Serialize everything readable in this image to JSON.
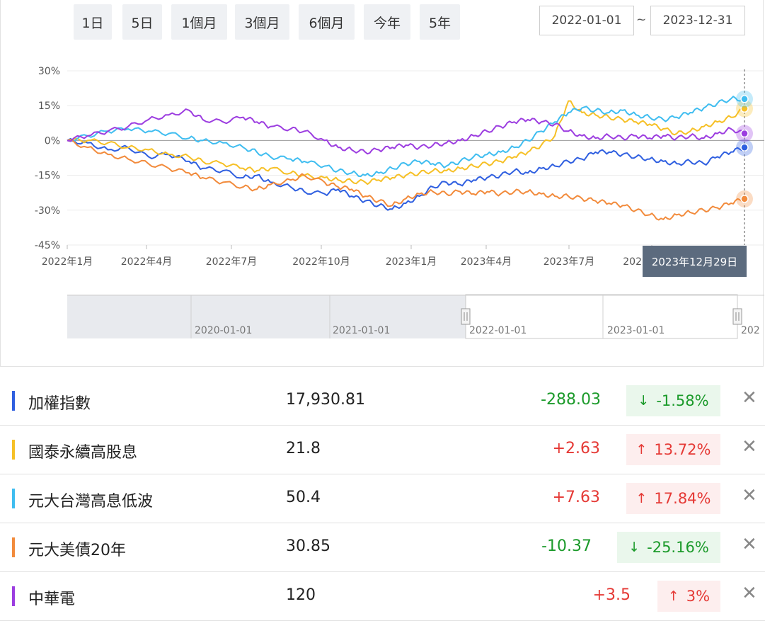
{
  "range_buttons": [
    "1日",
    "5日",
    "1個月",
    "3個月",
    "6個月",
    "今年",
    "5年"
  ],
  "date_range": {
    "start": "2022-01-01",
    "separator": "~",
    "end": "2023-12-31"
  },
  "tooltip_date": "2023年12月29日",
  "navigator": {
    "labels": [
      "2020-01-01",
      "2021-01-01",
      "2022-01-01",
      "2023-01-01",
      "202"
    ]
  },
  "chart_data": {
    "type": "line",
    "x_axis": {
      "tick_labels": [
        "2022年1月",
        "2022年4月",
        "2022年7月",
        "2022年10月",
        "2023年1月",
        "2023年4月",
        "2023年7月",
        "2023年10月"
      ]
    },
    "y_axis": {
      "tick_labels": [
        "30%",
        "15%",
        "0%",
        "-15%",
        "-30%",
        "-45%"
      ],
      "ylim": [
        -45,
        30
      ],
      "unit": "%"
    },
    "grid": true,
    "series": [
      {
        "name": "加權指數",
        "color": "#2f5fe0",
        "points": [
          [
            0,
            0
          ],
          [
            0.03,
            -1
          ],
          [
            0.06,
            -4
          ],
          [
            0.09,
            -3
          ],
          [
            0.12,
            -7
          ],
          [
            0.15,
            -6
          ],
          [
            0.18,
            -9
          ],
          [
            0.2,
            -12
          ],
          [
            0.23,
            -13
          ],
          [
            0.26,
            -16
          ],
          [
            0.28,
            -15
          ],
          [
            0.3,
            -18
          ],
          [
            0.33,
            -20
          ],
          [
            0.35,
            -22
          ],
          [
            0.38,
            -23
          ],
          [
            0.4,
            -21
          ],
          [
            0.42,
            -24
          ],
          [
            0.44,
            -26
          ],
          [
            0.46,
            -28
          ],
          [
            0.48,
            -29.5
          ],
          [
            0.5,
            -27
          ],
          [
            0.52,
            -24
          ],
          [
            0.54,
            -20
          ],
          [
            0.56,
            -18
          ],
          [
            0.58,
            -19
          ],
          [
            0.6,
            -17
          ],
          [
            0.62,
            -16
          ],
          [
            0.64,
            -15
          ],
          [
            0.66,
            -13
          ],
          [
            0.68,
            -14
          ],
          [
            0.7,
            -12
          ],
          [
            0.72,
            -11
          ],
          [
            0.74,
            -9
          ],
          [
            0.76,
            -8
          ],
          [
            0.78,
            -5
          ],
          [
            0.8,
            -5
          ],
          [
            0.82,
            -6
          ],
          [
            0.84,
            -7
          ],
          [
            0.86,
            -8
          ],
          [
            0.88,
            -9
          ],
          [
            0.9,
            -10
          ],
          [
            0.92,
            -9
          ],
          [
            0.94,
            -10
          ],
          [
            0.96,
            -7
          ],
          [
            0.98,
            -5
          ],
          [
            1,
            -3
          ]
        ]
      },
      {
        "name": "國泰永續高股息",
        "color": "#f6c026",
        "points": [
          [
            0,
            0
          ],
          [
            0.03,
            0
          ],
          [
            0.06,
            -1
          ],
          [
            0.09,
            -3
          ],
          [
            0.12,
            -4
          ],
          [
            0.15,
            -6
          ],
          [
            0.18,
            -7
          ],
          [
            0.2,
            -9
          ],
          [
            0.23,
            -10
          ],
          [
            0.26,
            -12
          ],
          [
            0.28,
            -13
          ],
          [
            0.3,
            -12
          ],
          [
            0.33,
            -14
          ],
          [
            0.35,
            -15
          ],
          [
            0.38,
            -16
          ],
          [
            0.4,
            -17
          ],
          [
            0.42,
            -17.5
          ],
          [
            0.44,
            -18
          ],
          [
            0.46,
            -17
          ],
          [
            0.48,
            -16
          ],
          [
            0.5,
            -15
          ],
          [
            0.52,
            -14
          ],
          [
            0.54,
            -13
          ],
          [
            0.56,
            -13
          ],
          [
            0.58,
            -12
          ],
          [
            0.6,
            -11
          ],
          [
            0.62,
            -10
          ],
          [
            0.64,
            -9
          ],
          [
            0.66,
            -7
          ],
          [
            0.68,
            -5
          ],
          [
            0.7,
            -2
          ],
          [
            0.72,
            2
          ],
          [
            0.74,
            17
          ],
          [
            0.76,
            12
          ],
          [
            0.78,
            11
          ],
          [
            0.8,
            10
          ],
          [
            0.82,
            9
          ],
          [
            0.84,
            8
          ],
          [
            0.86,
            7
          ],
          [
            0.88,
            5
          ],
          [
            0.9,
            3
          ],
          [
            0.92,
            4
          ],
          [
            0.94,
            6
          ],
          [
            0.96,
            8
          ],
          [
            0.98,
            10
          ],
          [
            1,
            13.72
          ]
        ]
      },
      {
        "name": "元大台灣高息低波",
        "color": "#3fbdf0",
        "points": [
          [
            0,
            0
          ],
          [
            0.03,
            2
          ],
          [
            0.06,
            4
          ],
          [
            0.09,
            5
          ],
          [
            0.12,
            4
          ],
          [
            0.15,
            3
          ],
          [
            0.18,
            1
          ],
          [
            0.2,
            0
          ],
          [
            0.23,
            -1
          ],
          [
            0.26,
            -3
          ],
          [
            0.28,
            -5
          ],
          [
            0.3,
            -7
          ],
          [
            0.33,
            -8
          ],
          [
            0.35,
            -9
          ],
          [
            0.38,
            -11
          ],
          [
            0.4,
            -13
          ],
          [
            0.42,
            -14
          ],
          [
            0.44,
            -15
          ],
          [
            0.46,
            -14
          ],
          [
            0.48,
            -12
          ],
          [
            0.5,
            -10
          ],
          [
            0.52,
            -9
          ],
          [
            0.54,
            -10
          ],
          [
            0.56,
            -11
          ],
          [
            0.58,
            -9
          ],
          [
            0.6,
            -7
          ],
          [
            0.62,
            -6
          ],
          [
            0.64,
            -5
          ],
          [
            0.66,
            -3
          ],
          [
            0.68,
            0
          ],
          [
            0.7,
            4
          ],
          [
            0.72,
            8
          ],
          [
            0.74,
            12
          ],
          [
            0.76,
            14
          ],
          [
            0.78,
            13
          ],
          [
            0.8,
            12
          ],
          [
            0.82,
            13
          ],
          [
            0.84,
            11
          ],
          [
            0.86,
            10
          ],
          [
            0.88,
            9
          ],
          [
            0.9,
            10
          ],
          [
            0.92,
            12
          ],
          [
            0.94,
            14
          ],
          [
            0.96,
            16
          ],
          [
            0.98,
            18
          ],
          [
            1,
            17.84
          ]
        ]
      },
      {
        "name": "元大美債20年",
        "color": "#f28b3c",
        "points": [
          [
            0,
            0
          ],
          [
            0.03,
            -3
          ],
          [
            0.06,
            -6
          ],
          [
            0.09,
            -8
          ],
          [
            0.12,
            -10
          ],
          [
            0.15,
            -12
          ],
          [
            0.18,
            -14
          ],
          [
            0.2,
            -16
          ],
          [
            0.23,
            -18
          ],
          [
            0.26,
            -20
          ],
          [
            0.28,
            -21
          ],
          [
            0.3,
            -19
          ],
          [
            0.33,
            -17
          ],
          [
            0.35,
            -15
          ],
          [
            0.38,
            -18
          ],
          [
            0.4,
            -20
          ],
          [
            0.42,
            -21
          ],
          [
            0.44,
            -24
          ],
          [
            0.46,
            -26
          ],
          [
            0.48,
            -28
          ],
          [
            0.5,
            -25
          ],
          [
            0.52,
            -23
          ],
          [
            0.54,
            -22
          ],
          [
            0.56,
            -23
          ],
          [
            0.58,
            -22
          ],
          [
            0.6,
            -23
          ],
          [
            0.62,
            -22
          ],
          [
            0.64,
            -23
          ],
          [
            0.66,
            -22
          ],
          [
            0.68,
            -22
          ],
          [
            0.7,
            -23
          ],
          [
            0.72,
            -24
          ],
          [
            0.74,
            -24
          ],
          [
            0.76,
            -25
          ],
          [
            0.78,
            -26
          ],
          [
            0.8,
            -27
          ],
          [
            0.82,
            -28
          ],
          [
            0.84,
            -30
          ],
          [
            0.86,
            -32
          ],
          [
            0.88,
            -34
          ],
          [
            0.9,
            -32
          ],
          [
            0.92,
            -31
          ],
          [
            0.94,
            -30
          ],
          [
            0.96,
            -29
          ],
          [
            0.98,
            -27
          ],
          [
            1,
            -25.16
          ]
        ]
      },
      {
        "name": "中華電",
        "color": "#9c3de0",
        "points": [
          [
            0,
            0
          ],
          [
            0.03,
            2
          ],
          [
            0.06,
            4
          ],
          [
            0.09,
            6
          ],
          [
            0.12,
            9
          ],
          [
            0.15,
            11
          ],
          [
            0.18,
            13
          ],
          [
            0.2,
            9
          ],
          [
            0.23,
            8
          ],
          [
            0.26,
            10
          ],
          [
            0.28,
            8
          ],
          [
            0.3,
            6
          ],
          [
            0.33,
            5
          ],
          [
            0.35,
            4
          ],
          [
            0.38,
            0
          ],
          [
            0.4,
            -3
          ],
          [
            0.42,
            -4
          ],
          [
            0.44,
            -5
          ],
          [
            0.46,
            -4
          ],
          [
            0.48,
            -3
          ],
          [
            0.5,
            -2
          ],
          [
            0.52,
            -3
          ],
          [
            0.54,
            -2
          ],
          [
            0.56,
            -1
          ],
          [
            0.58,
            0
          ],
          [
            0.6,
            2
          ],
          [
            0.62,
            4
          ],
          [
            0.64,
            6
          ],
          [
            0.66,
            8
          ],
          [
            0.68,
            9
          ],
          [
            0.7,
            8
          ],
          [
            0.72,
            7
          ],
          [
            0.74,
            4
          ],
          [
            0.76,
            2
          ],
          [
            0.78,
            1
          ],
          [
            0.8,
            2
          ],
          [
            0.82,
            1
          ],
          [
            0.84,
            2
          ],
          [
            0.86,
            1
          ],
          [
            0.88,
            2
          ],
          [
            0.9,
            1
          ],
          [
            0.92,
            2
          ],
          [
            0.94,
            1
          ],
          [
            0.96,
            3
          ],
          [
            0.98,
            5
          ],
          [
            1,
            3
          ]
        ]
      }
    ]
  },
  "legend": [
    {
      "name": "加權指數",
      "price": "17,930.81",
      "change": "-288.03",
      "pct": "-1.58%",
      "arrow": "↓",
      "direction": "down",
      "color": "#2f5fe0"
    },
    {
      "name": "國泰永續高股息",
      "price": "21.8",
      "change": "+2.63",
      "pct": "13.72%",
      "arrow": "↑",
      "direction": "up",
      "color": "#f6c026"
    },
    {
      "name": "元大台灣高息低波",
      "price": "50.4",
      "change": "+7.63",
      "pct": "17.84%",
      "arrow": "↑",
      "direction": "up",
      "color": "#3fbdf0"
    },
    {
      "name": "元大美債20年",
      "price": "30.85",
      "change": "-10.37",
      "pct": "-25.16%",
      "arrow": "↓",
      "direction": "down",
      "color": "#f28b3c"
    },
    {
      "name": "中華電",
      "price": "120",
      "change": "+3.5",
      "pct": "3%",
      "arrow": "↑",
      "direction": "up",
      "color": "#9c3de0"
    }
  ],
  "colors": {
    "up": "#e53935",
    "up_bg": "#fdeeee",
    "down": "#1b9a2a",
    "down_bg": "#eaf7ec"
  },
  "icons": {
    "close": "close-icon",
    "up": "arrow-up-icon",
    "down": "arrow-down-icon"
  }
}
